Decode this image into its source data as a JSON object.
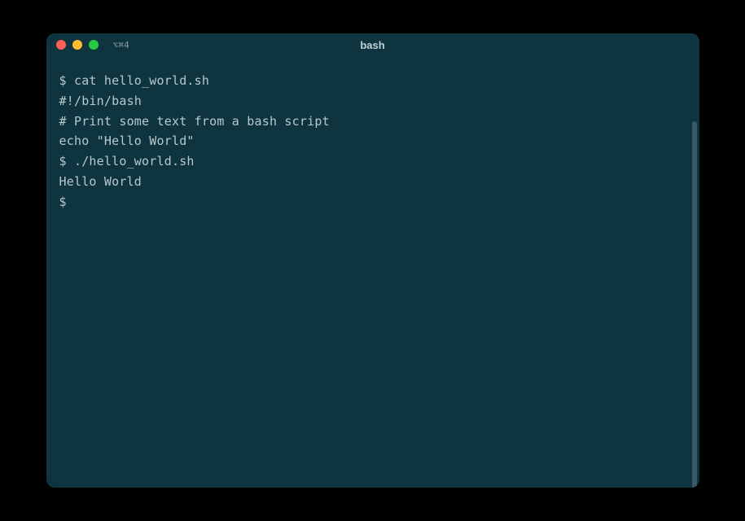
{
  "titlebar": {
    "tab_label": "⌥⌘4",
    "title": "bash"
  },
  "terminal": {
    "lines": [
      "$ cat hello_world.sh",
      "#!/bin/bash",
      "# Print some text from a bash script",
      "echo \"Hello World\"",
      "",
      "$ ./hello_world.sh",
      "Hello World",
      "$"
    ]
  }
}
